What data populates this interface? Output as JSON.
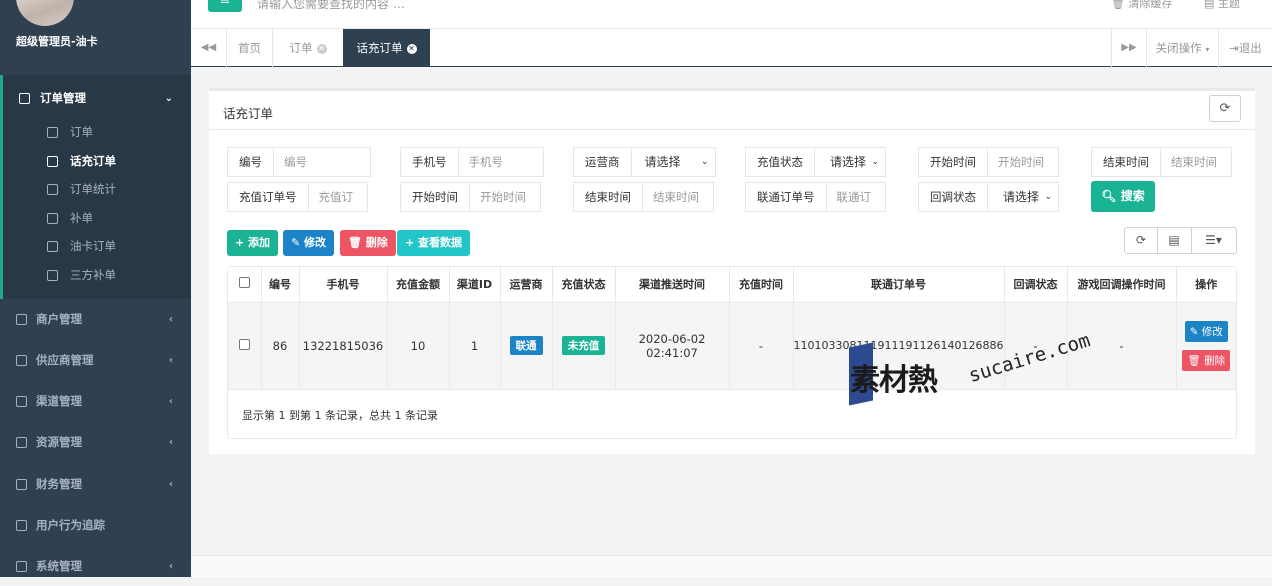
{
  "sidebar": {
    "admin_name": "超级管理员-油卡",
    "main_item": {
      "label": "订单管理",
      "arrow": "⌄"
    },
    "sub_items": [
      {
        "label": "订单"
      },
      {
        "label": "话充订单"
      },
      {
        "label": "订单统计"
      },
      {
        "label": "补单"
      },
      {
        "label": "油卡订单"
      },
      {
        "label": "三方补单"
      }
    ],
    "items": [
      {
        "label": "商户管理",
        "arrow": "‹"
      },
      {
        "label": "供应商管理",
        "arrow": "‹"
      },
      {
        "label": "渠道管理",
        "arrow": "‹"
      },
      {
        "label": "资源管理",
        "arrow": "‹"
      },
      {
        "label": "财务管理",
        "arrow": "‹"
      },
      {
        "label": "用户行为追踪",
        "arrow": ""
      },
      {
        "label": "系统管理",
        "arrow": "‹"
      }
    ]
  },
  "topbar": {
    "menu_toggle": "≡",
    "search_placeholder": "请输入您需要查找的内容 …",
    "clear_cache": "清除缓存",
    "theme": "主题"
  },
  "tabs": {
    "prev": "◀◀",
    "next": "▶▶",
    "items": [
      {
        "label": "首页"
      },
      {
        "label": "订单"
      },
      {
        "label": "话充订单"
      }
    ],
    "close_ops": "关闭操作",
    "logout": "退出"
  },
  "panel": {
    "title": "话充订单",
    "refresh": "⟳"
  },
  "filters": {
    "row1": [
      {
        "label": "编号",
        "placeholder": "编号"
      },
      {
        "label": "手机号",
        "placeholder": "手机号"
      },
      {
        "label": "运营商",
        "value": "请选择"
      },
      {
        "label": "充值状态",
        "value": "请选择"
      },
      {
        "label": "开始时间",
        "placeholder": "开始时间"
      },
      {
        "label": "结束时间",
        "placeholder": "结束时间"
      }
    ],
    "row2": [
      {
        "label": "充值订单号",
        "placeholder": "充值订"
      },
      {
        "label": "开始时间",
        "placeholder": "开始时间"
      },
      {
        "label": "结束时间",
        "placeholder": "结束时间"
      },
      {
        "label": "联通订单号",
        "placeholder": "联通订"
      },
      {
        "label": "回调状态",
        "value": "请选择"
      }
    ],
    "search_button": "搜索"
  },
  "actions": {
    "add": "+ 添加",
    "edit": "✎ 修改",
    "delete": "🗑 删除",
    "view": "+ 查看数据"
  },
  "table": {
    "headers": [
      "编号",
      "手机号",
      "充值金额",
      "渠道ID",
      "运营商",
      "充值状态",
      "渠道推送时间",
      "充值时间",
      "联通订单号",
      "回调状态",
      "游戏回调操作时间",
      "操作"
    ],
    "rows": [
      {
        "id": "86",
        "phone": "13221815036",
        "amount": "10",
        "channel_id": "1",
        "operator": "联通",
        "status": "未充值",
        "push_time_date": "2020-06-02",
        "push_time_time": "02:41:07",
        "charge_time": "-",
        "order_no": "1101033081119111911261401268​86",
        "callback_status": "-",
        "game_callback_time": "-",
        "edit": "✎ 修改",
        "delete": "🗑 删除"
      }
    ],
    "footer": "显示第 1 到第 1 条记录，总共 1 条记录"
  },
  "watermark": {
    "cn": "素材熱",
    "en": "sucaire.com"
  },
  "colors": {
    "sidebar_bg": "#2f4050",
    "primary": "#1ab394",
    "blue": "#1c84c6",
    "danger": "#ed5565"
  }
}
